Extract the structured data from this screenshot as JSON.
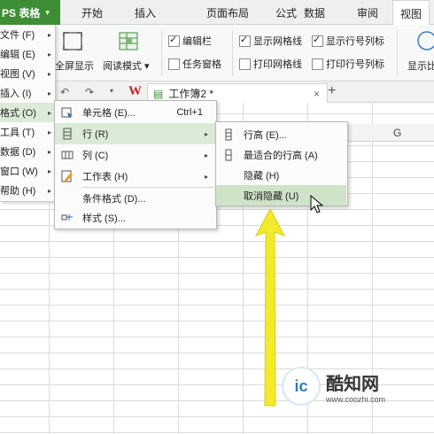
{
  "app": {
    "name": "PS 表格"
  },
  "ribbon_tabs": [
    "开始",
    "插入",
    "页面布局",
    "公式",
    "数据",
    "审阅",
    "视图"
  ],
  "ribbon": {
    "fullscreen_label": "全屏显示",
    "reading_mode_label": "阅读模式",
    "checkboxes": [
      {
        "label": "编辑栏",
        "checked": true
      },
      {
        "label": "任务窗格",
        "checked": false
      },
      {
        "label": "显示网格线",
        "checked": true
      },
      {
        "label": "打印网格线",
        "checked": false
      },
      {
        "label": "显示行号列标",
        "checked": true
      },
      {
        "label": "打印行号列标",
        "checked": false
      }
    ],
    "display_label": "显示比"
  },
  "doc_tab": {
    "title": "工作簿2 *",
    "close": "×",
    "new": "+"
  },
  "column_header": {
    "g": "G"
  },
  "app_menu": [
    {
      "label": "文件 (F)"
    },
    {
      "label": "编辑 (E)"
    },
    {
      "label": "视图 (V)"
    },
    {
      "label": "插入 (I)"
    },
    {
      "label": "格式 (O)"
    },
    {
      "label": "工具 (T)"
    },
    {
      "label": "数据 (D)"
    },
    {
      "label": "窗口 (W)"
    },
    {
      "label": "帮助 (H)"
    }
  ],
  "format_menu": {
    "cell": {
      "label": "单元格 (E)...",
      "shortcut": "Ctrl+1"
    },
    "row": {
      "label": "行 (R)"
    },
    "column": {
      "label": "列 (C)"
    },
    "sheet": {
      "label": "工作表 (H)"
    },
    "conditional": {
      "label": "条件格式 (D)..."
    },
    "style": {
      "label": "样式 (S)..."
    }
  },
  "row_menu": {
    "height": {
      "label": "行高 (E)..."
    },
    "autofit": {
      "label": "最适合的行高 (A)"
    },
    "hide": {
      "label": "隐藏 (H)"
    },
    "unhide": {
      "label": "取消隐藏 (U)"
    }
  },
  "watermark": {
    "name": "酷知网",
    "url": "www.coozhi.com"
  },
  "colors": {
    "green_accent": "#3e8e36",
    "highlight": "#dcebd8",
    "arrow_yellow": "#f2ea2a"
  }
}
